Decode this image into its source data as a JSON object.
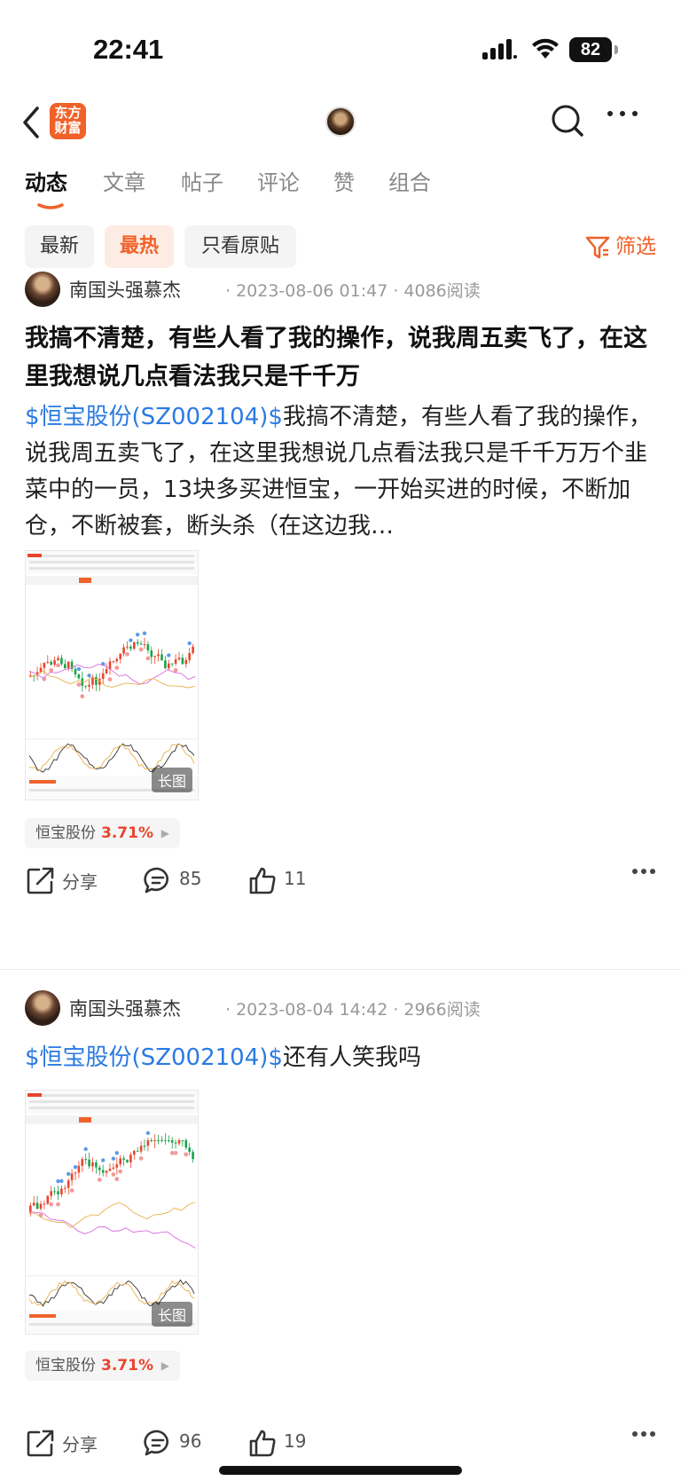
{
  "status_bar": {
    "time": "22:41",
    "battery": "82"
  },
  "nav": {
    "logo_line1": "东方",
    "logo_line2": "财富"
  },
  "tabs": [
    "动态",
    "文章",
    "帖子",
    "评论",
    "赞",
    "组合"
  ],
  "filters": {
    "chips": [
      "最新",
      "最热",
      "只看原贴"
    ],
    "filter_label": "筛选"
  },
  "colors": {
    "accent": "#f0622a",
    "link": "#2a7ae2",
    "up": "#e8452c"
  },
  "posts": [
    {
      "author": "南国头强慕杰",
      "meta": "· 2023-08-06 01:47 · 4086阅读",
      "title": "我搞不清楚，有些人看了我的操作，说我周五卖飞了，在这里我想说几点看法我只是千千万",
      "body_link": "$恒宝股份(SZ002104)$",
      "body_text": "我搞不清楚，有些人看了我的操作，说我周五卖飞了，在这里我想说几点看法我只是千千万万个韭菜中的一员，13块多买进恒宝，一开始买进的时候，不断加仓，不断被套，断头杀（在这边我…",
      "image_badge": "长图",
      "stock_tag": {
        "name": "恒宝股份",
        "pct": "3.71%"
      },
      "share_label": "分享",
      "comments": "85",
      "likes": "11"
    },
    {
      "author": "南国头强慕杰",
      "meta": "· 2023-08-04 14:42 · 2966阅读",
      "body_link": "$恒宝股份(SZ002104)$",
      "body_text": "还有人笑我吗",
      "image_badge": "长图",
      "stock_tag": {
        "name": "恒宝股份",
        "pct": "3.71%"
      },
      "share_label": "分享",
      "comments": "96",
      "likes": "19"
    }
  ]
}
